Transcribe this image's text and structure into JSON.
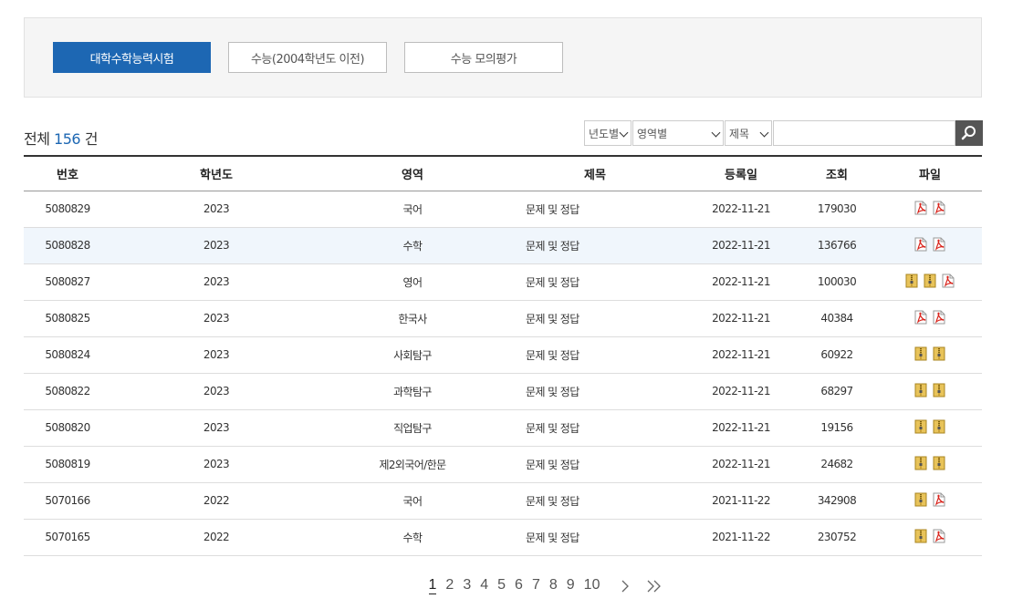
{
  "tabs": [
    {
      "label": "대학수학능력시험",
      "active": true
    },
    {
      "label": "수능(2004학년도 이전)",
      "active": false
    },
    {
      "label": "수능 모의평가",
      "active": false
    }
  ],
  "total": {
    "prefix": "전체",
    "count": "156",
    "suffix": "건"
  },
  "search": {
    "year_select": "년도별",
    "area_select": "영역별",
    "field_select": "제목",
    "query": ""
  },
  "table": {
    "headers": [
      "번호",
      "학년도",
      "영역",
      "제목",
      "등록일",
      "조회",
      "파일"
    ],
    "rows": [
      {
        "id": "5080829",
        "year": "2023",
        "area": "국어",
        "title": "문제 및 정답",
        "date": "2022-11-21",
        "views": "179030",
        "files": [
          "pdf",
          "pdf"
        ],
        "highlight": false
      },
      {
        "id": "5080828",
        "year": "2023",
        "area": "수학",
        "title": "문제 및 정답",
        "date": "2022-11-21",
        "views": "136766",
        "files": [
          "pdf",
          "pdf"
        ],
        "highlight": true
      },
      {
        "id": "5080827",
        "year": "2023",
        "area": "영어",
        "title": "문제 및 정답",
        "date": "2022-11-21",
        "views": "100030",
        "files": [
          "zip",
          "zip",
          "pdf"
        ],
        "highlight": false
      },
      {
        "id": "5080825",
        "year": "2023",
        "area": "한국사",
        "title": "문제 및 정답",
        "date": "2022-11-21",
        "views": "40384",
        "files": [
          "pdf",
          "pdf"
        ],
        "highlight": false
      },
      {
        "id": "5080824",
        "year": "2023",
        "area": "사회탐구",
        "title": "문제 및 정답",
        "date": "2022-11-21",
        "views": "60922",
        "files": [
          "zip",
          "zip"
        ],
        "highlight": false
      },
      {
        "id": "5080822",
        "year": "2023",
        "area": "과학탐구",
        "title": "문제 및 정답",
        "date": "2022-11-21",
        "views": "68297",
        "files": [
          "zip",
          "zip"
        ],
        "highlight": false
      },
      {
        "id": "5080820",
        "year": "2023",
        "area": "직업탐구",
        "title": "문제 및 정답",
        "date": "2022-11-21",
        "views": "19156",
        "files": [
          "zip",
          "zip"
        ],
        "highlight": false
      },
      {
        "id": "5080819",
        "year": "2023",
        "area": "제2외국어/한문",
        "title": "문제 및 정답",
        "date": "2022-11-21",
        "views": "24682",
        "files": [
          "zip",
          "zip"
        ],
        "highlight": false
      },
      {
        "id": "5070166",
        "year": "2022",
        "area": "국어",
        "title": "문제 및 정답",
        "date": "2021-11-22",
        "views": "342908",
        "files": [
          "zip",
          "pdf"
        ],
        "highlight": false
      },
      {
        "id": "5070165",
        "year": "2022",
        "area": "수학",
        "title": "문제 및 정답",
        "date": "2021-11-22",
        "views": "230752",
        "files": [
          "zip",
          "pdf"
        ],
        "highlight": false
      }
    ]
  },
  "pagination": {
    "pages": [
      "1",
      "2",
      "3",
      "4",
      "5",
      "6",
      "7",
      "8",
      "9",
      "10"
    ],
    "current": "1",
    "next_icon": "chevron-right-icon",
    "last_icon": "double-chevron-right-icon"
  },
  "colors": {
    "accent": "#1d67b3",
    "highlight_row": "#f0f6fc",
    "search_button": "#555555"
  }
}
